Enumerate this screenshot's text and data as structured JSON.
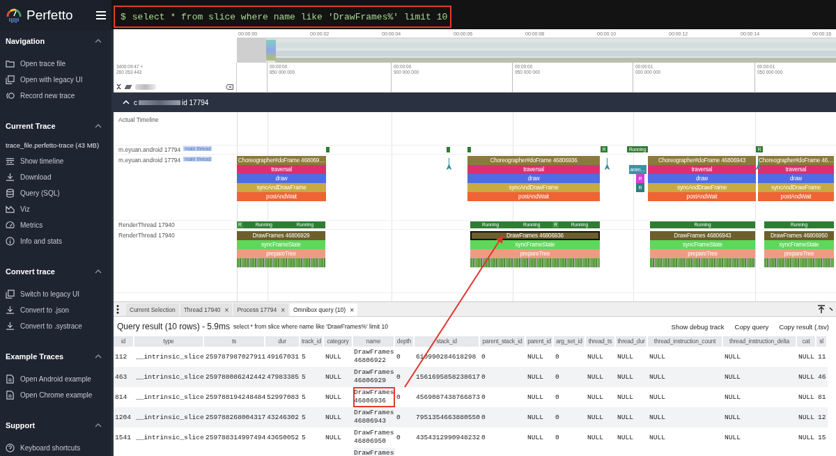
{
  "sidebar": {
    "brand": "Perfetto",
    "sections": [
      {
        "title": "Navigation",
        "expanded": true,
        "items": [
          "Open trace file",
          "Open with legacy UI",
          "Record new trace"
        ]
      },
      {
        "title": "Current Trace",
        "expanded": true,
        "trace_file": "trace_file.perfetto-trace (43 MB)",
        "items": [
          "Show timeline",
          "Download",
          "Query (SQL)",
          "Viz",
          "Metrics",
          "Info and stats"
        ]
      },
      {
        "title": "Convert trace",
        "expanded": true,
        "items": [
          "Switch to legacy UI",
          "Convert to .json",
          "Convert to .systrace"
        ]
      },
      {
        "title": "Example Traces",
        "expanded": true,
        "items": [
          "Open Android example",
          "Open Chrome example"
        ]
      },
      {
        "title": "Support",
        "expanded": true,
        "items": [
          "Keyboard shortcuts"
        ]
      }
    ]
  },
  "omnibox": {
    "prompt": "$",
    "value": "select * from slice where name like 'DrawFrames%' limit 10",
    "highlighted": true
  },
  "overview": {
    "ticks": [
      "00:00:00",
      "00:00:02",
      "00:00:04",
      "00:00:06",
      "00:00:08",
      "00:00:10",
      "00:00:12",
      "00:00:14",
      "00:00:16"
    ]
  },
  "ruler": {
    "offset": "3d00:09:47 +",
    "offset_ns": "260 263 443",
    "ticks": [
      {
        "time": "00:00:00",
        "ns": "850 000 000"
      },
      {
        "time": "00:00:00",
        "ns": "900 000 000"
      },
      {
        "time": "00:00:00",
        "ns": "950 000 000"
      },
      {
        "time": "00:00:01",
        "ns": "000 000 000"
      },
      {
        "time": "00:00:01",
        "ns": "050 000 000"
      }
    ]
  },
  "process": {
    "name_start": "c",
    "name_end": "id 17794",
    "expanded": true
  },
  "tracks": {
    "actual_timeline": "Actual Timeline",
    "main_state": {
      "name": "m.eyuan.android 17794",
      "tag": "main thread",
      "states": [
        "R",
        "Running",
        "R"
      ]
    },
    "main": {
      "name": "m.eyuan.android 17794",
      "tag": "main thread"
    },
    "render_state": {
      "name": "RenderThread 17940"
    },
    "render": {
      "name": "RenderThread 17940"
    }
  },
  "frames": [
    {
      "main": [
        "Choreographer#doFrame 468069…",
        "traversal",
        "draw",
        "syncAndDrawFrame",
        "postAndWait"
      ],
      "render": [
        "DrawFrames 46806929",
        "syncFrameState",
        "prepareTree"
      ],
      "render_states": [
        {
          "kind": "runnable",
          "text": "R"
        },
        {
          "kind": "running",
          "text": "Running"
        },
        {
          "kind": "running",
          "text": "Running"
        }
      ],
      "selected": false
    },
    {
      "main": [
        "Choreographer#doFrame 46806936",
        "traversal",
        "draw",
        "syncAndDrawFrame",
        "postAndWait"
      ],
      "render": [
        "DrawFrames 46806936",
        "syncFrameState",
        "prepareTree"
      ],
      "render_states": [
        {
          "kind": "running",
          "text": "Running"
        },
        {
          "kind": "running",
          "text": "Running"
        },
        {
          "kind": "runnable",
          "text": "R"
        },
        {
          "kind": "running",
          "text": "Running"
        }
      ],
      "selected": true
    },
    {
      "main": [
        "Choreographer#doFrame 46806943",
        "traversal",
        "draw",
        "syncAndDrawFrame",
        "postAndWait"
      ],
      "render": [
        "DrawFrames 46806943",
        "syncFrameState",
        "prepareTree"
      ],
      "render_states": [
        {
          "kind": "running",
          "text": "Running"
        }
      ],
      "selected": false
    },
    {
      "main": [
        "Choreographer#doFrame 46…",
        "traversal",
        "draw",
        "syncAndDrawFrame",
        "postAndWait"
      ],
      "render": [
        "DrawFrames 46806950",
        "syncFrameState",
        "prepareTree"
      ],
      "render_states": [
        {
          "kind": "running",
          "text": "Running"
        }
      ],
      "selected": false
    }
  ],
  "extra_slices": [
    {
      "text": "anim…",
      "color": "#3a93a5"
    },
    {
      "text": "R",
      "color": "#d63fd6"
    },
    {
      "text": "R",
      "color": "#2f7d7d"
    }
  ],
  "panel": {
    "tabs": [
      {
        "label": "Current Selection",
        "closable": false,
        "selected": false
      },
      {
        "label": "Thread 17940",
        "closable": true,
        "selected": false
      },
      {
        "label": "Process 17794",
        "closable": true,
        "selected": false
      },
      {
        "label": "Omnibox query (10)",
        "closable": true,
        "selected": true
      }
    ],
    "close_glyph": "×",
    "query": {
      "title": "Query result (10 rows) - 5.9ms",
      "sql": "select * from slice where name like 'DrawFrames%' limit 10",
      "actions": [
        "Show debug track",
        "Copy query",
        "Copy result (.tsv)"
      ]
    },
    "table": {
      "columns": [
        "id",
        "type",
        "ts",
        "dur",
        "track_id",
        "category",
        "name",
        "depth",
        "stack_id",
        "parent_stack_id",
        "parent_id",
        "arg_set_id",
        "thread_ts",
        "thread_dur",
        "thread_instruction_count",
        "thread_instruction_delta",
        "cat",
        "sl"
      ],
      "rows": [
        {
          "cells": [
            "112",
            "__intrinsic_slice",
            "259787987027911",
            "49167031",
            "5",
            "NULL",
            "DrawFrames 46806922",
            "0",
            "610990284618298",
            "0",
            "NULL",
            "0",
            "NULL",
            "NULL",
            "NULL",
            "NULL",
            "NULL",
            "11"
          ],
          "highlighted": false
        },
        {
          "cells": [
            "463",
            "__intrinsic_slice",
            "259788086242442",
            "47983385",
            "5",
            "NULL",
            "DrawFrames 46806929",
            "0",
            "1561695858238617",
            "0",
            "NULL",
            "0",
            "NULL",
            "NULL",
            "NULL",
            "NULL",
            "NULL",
            "46"
          ],
          "highlighted": false
        },
        {
          "cells": [
            "814",
            "__intrinsic_slice",
            "259788194248484",
            "52997083",
            "5",
            "NULL",
            "DrawFrames 46806936",
            "0",
            "4569087438766873",
            "0",
            "NULL",
            "0",
            "NULL",
            "NULL",
            "NULL",
            "NULL",
            "NULL",
            "81"
          ],
          "highlighted": true
        },
        {
          "cells": [
            "1204",
            "__intrinsic_slice",
            "259788268004317",
            "43246302",
            "5",
            "NULL",
            "DrawFrames 46806943",
            "0",
            "7951354663880550",
            "0",
            "NULL",
            "0",
            "NULL",
            "NULL",
            "NULL",
            "NULL",
            "NULL",
            "12"
          ],
          "highlighted": false
        },
        {
          "cells": [
            "1541",
            "__intrinsic_slice",
            "259788314997494",
            "43650052",
            "5",
            "NULL",
            "DrawFrames 46806950",
            "0",
            "4354312990948232",
            "0",
            "NULL",
            "0",
            "NULL",
            "NULL",
            "NULL",
            "NULL",
            "NULL",
            "15"
          ],
          "highlighted": false
        },
        {
          "cells": [
            null,
            null,
            null,
            null,
            null,
            null,
            "DrawFrames",
            null,
            null,
            null,
            null,
            null,
            null,
            null,
            null,
            null,
            null,
            null
          ],
          "highlighted": false
        }
      ]
    }
  }
}
